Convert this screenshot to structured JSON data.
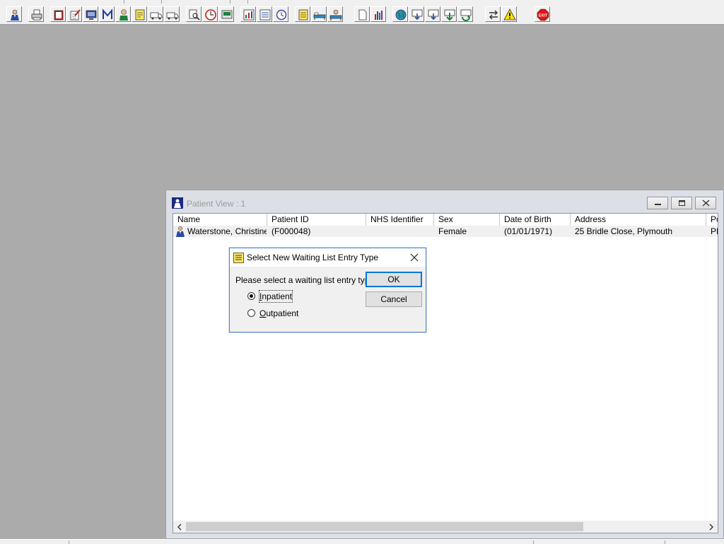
{
  "toolbar": {
    "buttons": [
      {
        "id": "patient",
        "icon": "patient-icon"
      },
      {
        "id": "print",
        "icon": "printer-icon"
      },
      {
        "id": "record-book",
        "icon": "book-icon"
      },
      {
        "id": "edit-notes",
        "icon": "notes-icon"
      },
      {
        "id": "monitor",
        "icon": "monitor-icon"
      },
      {
        "id": "m-letter",
        "icon": "m-letter-icon"
      },
      {
        "id": "doctor",
        "icon": "doctor-icon"
      },
      {
        "id": "form",
        "icon": "form-icon"
      },
      {
        "id": "ambulance",
        "icon": "ambulance-icon"
      },
      {
        "id": "ambulance-2",
        "icon": "ambulance-icon"
      },
      {
        "id": "search-doc",
        "icon": "search-document-icon"
      },
      {
        "id": "clock",
        "icon": "clock-icon"
      },
      {
        "id": "display",
        "icon": "display-icon"
      },
      {
        "id": "chart-doc",
        "icon": "chart-document-icon"
      },
      {
        "id": "list-doc",
        "icon": "list-document-icon"
      },
      {
        "id": "clock-doc",
        "icon": "clock-document-icon"
      },
      {
        "id": "notepad",
        "icon": "notepad-icon"
      },
      {
        "id": "bed",
        "icon": "bed-icon"
      },
      {
        "id": "bed-person",
        "icon": "bed-person-icon"
      },
      {
        "id": "blank-page",
        "icon": "blank-page-icon"
      },
      {
        "id": "bar-chart",
        "icon": "bar-chart-icon"
      },
      {
        "id": "globe",
        "icon": "globe-icon"
      },
      {
        "id": "download-1",
        "icon": "download-icon"
      },
      {
        "id": "download-2",
        "icon": "download-icon"
      },
      {
        "id": "down-arrow",
        "icon": "down-arrow-icon"
      },
      {
        "id": "refresh",
        "icon": "refresh-icon"
      },
      {
        "id": "transfer",
        "icon": "transfer-icon"
      },
      {
        "id": "warning",
        "icon": "warning-icon"
      },
      {
        "id": "exit",
        "icon": "exit-icon",
        "label": "EXIT"
      }
    ]
  },
  "patient_view": {
    "title": "Patient View : 1",
    "columns": [
      "Name",
      "Patient ID",
      "NHS Identifier",
      "Sex",
      "Date of Birth",
      "Address",
      "Po"
    ],
    "rows": [
      {
        "name": "Waterstone, Christine...",
        "patient_id": "(F000048)",
        "nhs": "",
        "sex": "Female",
        "dob": "(01/01/1971)",
        "address": "25 Bridle Close, Plymouth",
        "po": "PL"
      }
    ]
  },
  "dialog": {
    "title": "Select New Waiting List Entry Type",
    "prompt": "Please select a waiting list entry type",
    "ok_label": "OK",
    "cancel_label": "Cancel",
    "options": [
      {
        "label_first": "I",
        "label_rest": "npatient",
        "selected": true
      },
      {
        "label_first": "O",
        "label_rest": "utpatient",
        "selected": false
      }
    ]
  }
}
